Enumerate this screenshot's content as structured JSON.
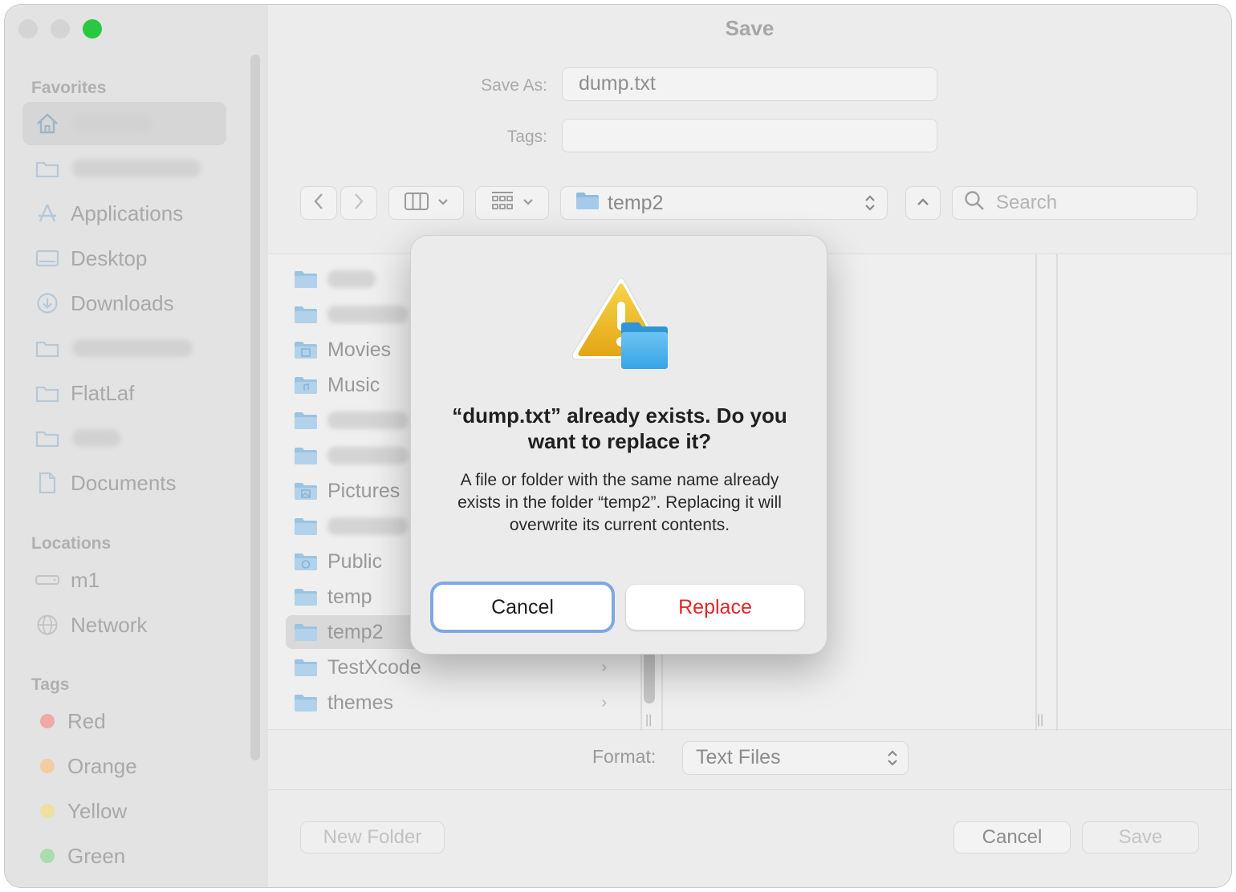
{
  "window": {
    "title": "Save"
  },
  "colors": {
    "close": "#d4d4d4",
    "minimize": "#d4d4d4",
    "zoom": "#2ac840",
    "accent": "#7ea8e6",
    "destructive": "#e0262b",
    "tag_red": "#f0a8a8",
    "tag_orange": "#f3cda0",
    "tag_yellow": "#efe0a0",
    "tag_green": "#a9dcae"
  },
  "sidebar": {
    "favorites_header": "Favorites",
    "favorites": [
      {
        "label": "",
        "icon": "home-icon",
        "selected": true,
        "blurred": true
      },
      {
        "label": "",
        "icon": "folder-icon",
        "blurred": true
      },
      {
        "label": "Applications",
        "icon": "applications-icon"
      },
      {
        "label": "Desktop",
        "icon": "desktop-icon"
      },
      {
        "label": "Downloads",
        "icon": "downloads-icon"
      },
      {
        "label": "",
        "icon": "folder-icon",
        "blurred": true
      },
      {
        "label": "FlatLaf",
        "icon": "folder-icon"
      },
      {
        "label": "",
        "icon": "folder-icon",
        "blurred": true
      },
      {
        "label": "Documents",
        "icon": "document-icon"
      }
    ],
    "locations_header": "Locations",
    "locations": [
      {
        "label": "m1",
        "icon": "drive-icon"
      },
      {
        "label": "Network",
        "icon": "network-icon"
      }
    ],
    "tags_header": "Tags",
    "tags": [
      {
        "label": "Red"
      },
      {
        "label": "Orange"
      },
      {
        "label": "Yellow"
      },
      {
        "label": "Green"
      }
    ]
  },
  "save_form": {
    "save_as_label": "Save As:",
    "save_as_value": "dump.txt",
    "tags_label": "Tags:",
    "tags_value": ""
  },
  "toolbar": {
    "current_folder": "temp2",
    "search_placeholder": "Search"
  },
  "files": [
    {
      "name": "",
      "blurred": true
    },
    {
      "name": "",
      "blurred": true
    },
    {
      "name": "Movies"
    },
    {
      "name": "Music"
    },
    {
      "name": "",
      "blurred": true
    },
    {
      "name": "",
      "blurred": true
    },
    {
      "name": "Pictures"
    },
    {
      "name": "",
      "blurred": true
    },
    {
      "name": "Public"
    },
    {
      "name": "temp"
    },
    {
      "name": "temp2",
      "selected": true
    },
    {
      "name": "TestXcode",
      "chevron": "›"
    },
    {
      "name": "themes",
      "chevron": "›"
    }
  ],
  "format": {
    "label": "Format:",
    "value": "Text Files"
  },
  "bottom": {
    "new_folder": "New Folder",
    "cancel": "Cancel",
    "save": "Save"
  },
  "dialog": {
    "title": "“dump.txt” already exists. Do you want to replace it?",
    "message": "A file or folder with the same name already exists in the folder “temp2”. Replacing it will overwrite its current contents.",
    "cancel": "Cancel",
    "replace": "Replace"
  }
}
